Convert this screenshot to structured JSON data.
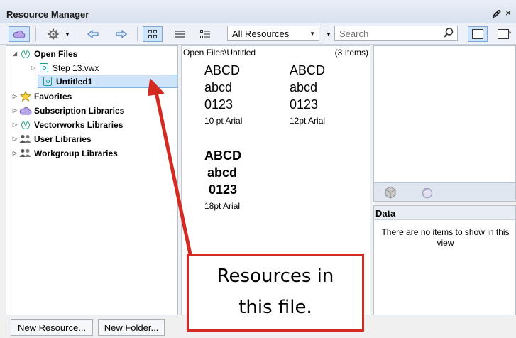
{
  "window": {
    "title": "Resource Manager",
    "pin_label": "↑p",
    "close_label": "×"
  },
  "toolbar": {
    "library_filter": "All Resources",
    "search_placeholder": "Search"
  },
  "tree": {
    "items": [
      {
        "label": "Open Files"
      },
      {
        "label": "Step 13.vwx"
      },
      {
        "label": "Untitled1"
      },
      {
        "label": "Favorites"
      },
      {
        "label": "Subscription Libraries"
      },
      {
        "label": "Vectorworks Libraries"
      },
      {
        "label": "User Libraries"
      },
      {
        "label": "Workgroup Libraries"
      }
    ]
  },
  "browser": {
    "path": "Open Files\\Untitled",
    "count": "(3 Items)",
    "resources": [
      {
        "line1": "ABCD",
        "line2": "abcd",
        "line3": "0123",
        "caption": "10 pt Arial"
      },
      {
        "line1": "ABCD",
        "line2": "abcd",
        "line3": "0123",
        "caption": "12pt Arial"
      },
      {
        "line1": "ABCD",
        "line2": "abcd",
        "line3": "0123",
        "caption": "18pt Arial"
      }
    ]
  },
  "data_pane": {
    "title": "Data",
    "empty_message": "There are no items to show in this view"
  },
  "buttons": {
    "new_resource": "New Resource...",
    "new_folder": "New Folder..."
  },
  "annotation": {
    "line1": "Resources in",
    "line2": "this file."
  },
  "colors": {
    "accent": "#7eb4ea",
    "callout": "#d42a24"
  }
}
